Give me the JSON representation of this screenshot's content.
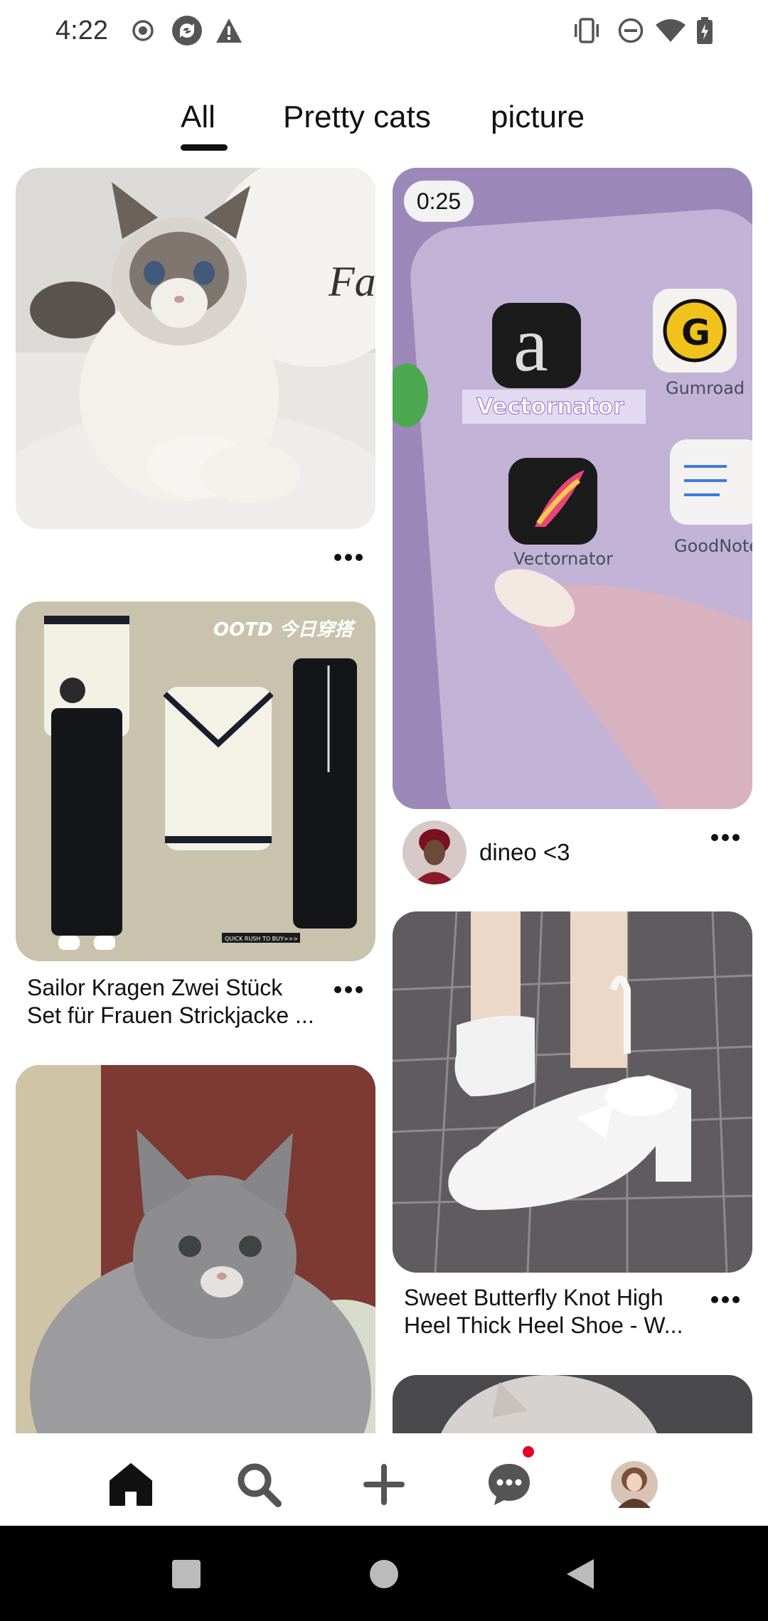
{
  "status_bar": {
    "time": "4:22",
    "icons": [
      "record-icon",
      "sync-icon",
      "warning-icon",
      "vibrate-icon",
      "do-not-disturb-icon",
      "wifi-icon",
      "battery-charging-icon"
    ]
  },
  "tabs": [
    {
      "label": "All",
      "selected": true
    },
    {
      "label": "Pretty cats",
      "selected": false
    },
    {
      "label": "picture",
      "selected": false
    }
  ],
  "pins": {
    "cat_ragdoll": {
      "image": "ragdoll cat"
    },
    "cardigan": {
      "image_text": "OOTD 今日穿搭",
      "image_button_text": "QUICK RUSH TO BUY>>>",
      "title_line1": "Sailor Kragen Zwei Stück",
      "title_line2": "Set für Frauen Strickjacke ..."
    },
    "kitten": {
      "image": "grey kitten"
    },
    "video": {
      "duration": "0:25",
      "app_labels": [
        "Vectornator",
        "Gumroad",
        "Vectornator",
        "GoodNote"
      ],
      "creator": "dineo <3"
    },
    "shoes": {
      "title_line1": "Sweet Butterfly Knot High",
      "title_line2": "Heel Thick Heel Shoe - W..."
    }
  },
  "bottom_nav": [
    "home-icon",
    "search-icon",
    "plus-icon",
    "messages-icon",
    "profile-avatar"
  ],
  "system_nav": [
    "recents-button",
    "home-button",
    "back-button"
  ],
  "colors": {
    "accent": "#e60023",
    "text": "#111111",
    "background": "#ffffff"
  }
}
